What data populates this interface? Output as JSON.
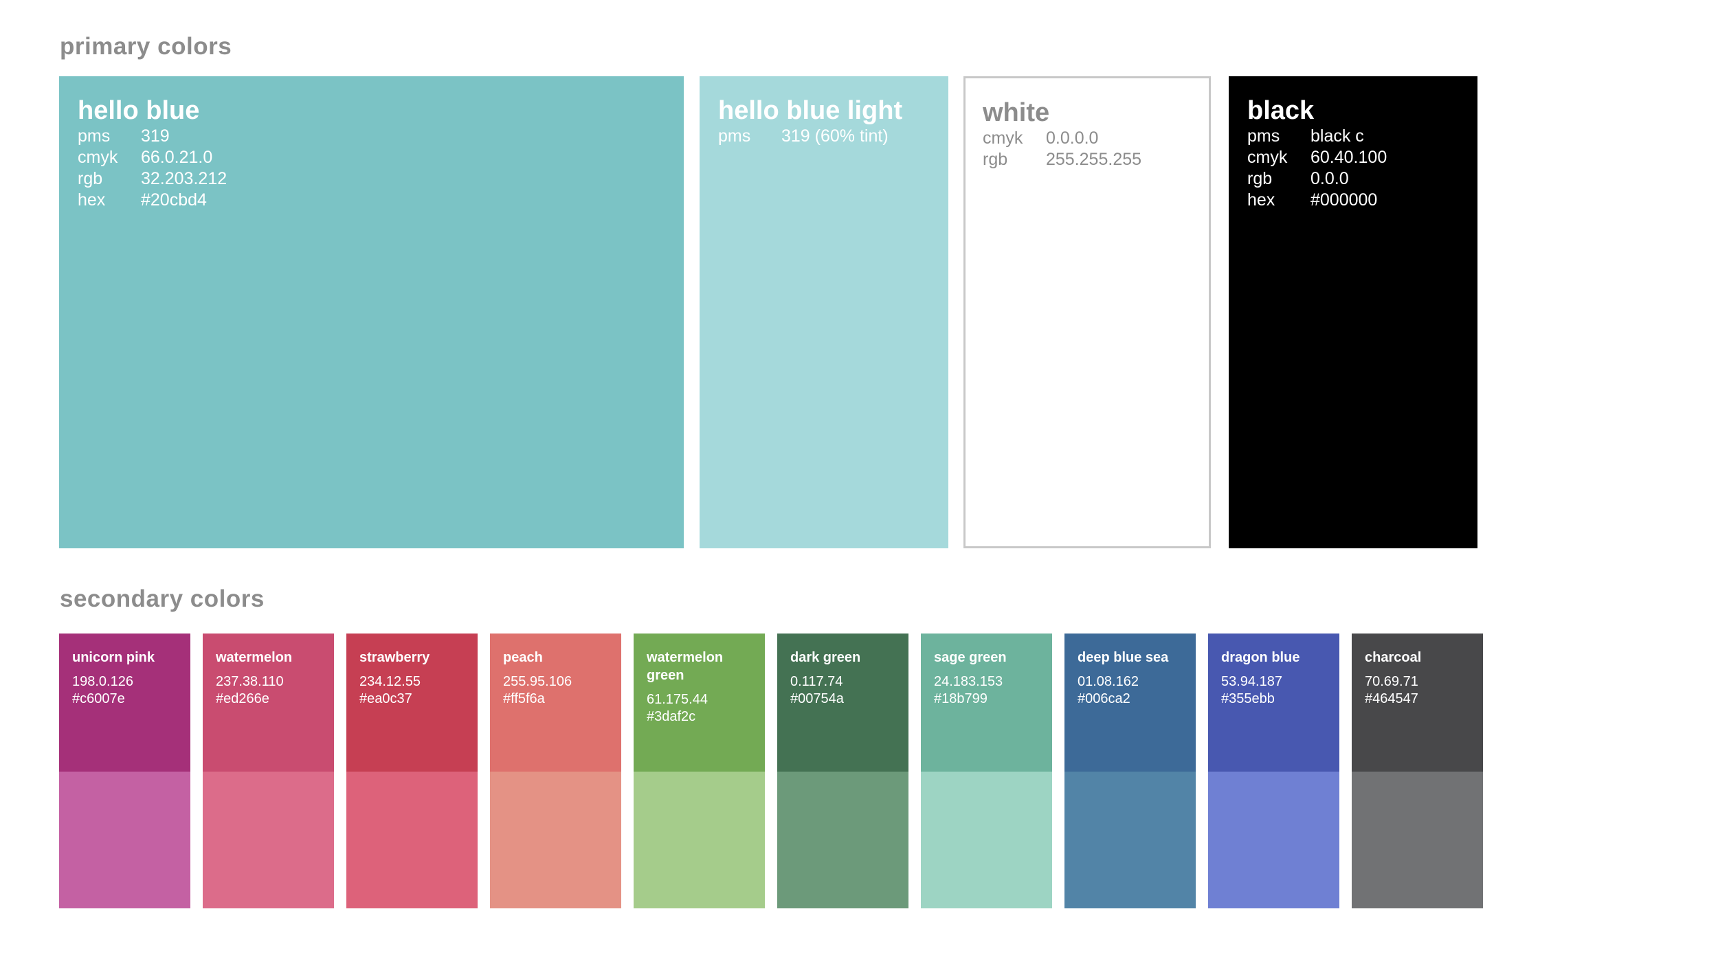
{
  "primary_title": "primary colors",
  "secondary_title": "secondary colors",
  "primary": [
    {
      "id": "hello-blue",
      "name": "hello blue",
      "bg": "#7bc3c5",
      "text_color": "#ffffff",
      "rows": [
        {
          "key": "pms",
          "value": "319"
        },
        {
          "key": "cmyk",
          "value": "66.0.21.0"
        },
        {
          "key": "rgb",
          "value": "32.203.212"
        },
        {
          "key": "hex",
          "value": "#20cbd4"
        }
      ]
    },
    {
      "id": "hello-blue-light",
      "name": "hello blue light",
      "bg": "#a5d9db",
      "text_color": "#ffffff",
      "rows": [
        {
          "key": "pms",
          "value": "319 (60% tint)"
        }
      ]
    },
    {
      "id": "white",
      "name": "white",
      "bg": "#ffffff",
      "text_color": "#8c8c8c",
      "rows": [
        {
          "key": "cmyk",
          "value": "0.0.0.0"
        },
        {
          "key": "rgb",
          "value": "255.255.255"
        }
      ]
    },
    {
      "id": "black",
      "name": "black",
      "bg": "#000000",
      "text_color": "#ffffff",
      "rows": [
        {
          "key": "pms",
          "value": "black c"
        },
        {
          "key": "cmyk",
          "value": "60.40.100"
        },
        {
          "key": "rgb",
          "value": "0.0.0"
        },
        {
          "key": "hex",
          "value": "#000000"
        }
      ]
    }
  ],
  "secondary": [
    {
      "name": "unicorn pink",
      "rgb": "198.0.126",
      "hex": "#c6007e",
      "top": "#a53079",
      "bottom": "#c461a3"
    },
    {
      "name": "watermelon",
      "rgb": "237.38.110",
      "hex": "#ed266e",
      "top": "#c94c70",
      "bottom": "#dc6c8a"
    },
    {
      "name": "strawberry",
      "rgb": "234.12.55",
      "hex": "#ea0c37",
      "top": "#c63f53",
      "bottom": "#dd627a"
    },
    {
      "name": "peach",
      "rgb": "255.95.106",
      "hex": "#ff5f6a",
      "top": "#de716d",
      "bottom": "#e49285"
    },
    {
      "name": "watermelon green",
      "rgb": "61.175.44",
      "hex": "#3daf2c",
      "top": "#73aa54",
      "bottom": "#a5cc8b"
    },
    {
      "name": "dark green",
      "rgb": "0.117.74",
      "hex": "#00754a",
      "top": "#447253",
      "bottom": "#6c9a7a"
    },
    {
      "name": "sage green",
      "rgb": "24.183.153",
      "hex": "#18b799",
      "top": "#6db39d",
      "bottom": "#9dd4c3"
    },
    {
      "name": "deep blue sea",
      "rgb": "01.08.162",
      "hex": "#006ca2",
      "top": "#3d6a98",
      "bottom": "#5284a7"
    },
    {
      "name": "dragon blue",
      "rgb": "53.94.187",
      "hex": "#355ebb",
      "top": "#4858b0",
      "bottom": "#6f80d3"
    },
    {
      "name": "charcoal",
      "rgb": "70.69.71",
      "hex": "#464547",
      "top": "#48484a",
      "bottom": "#717274"
    }
  ]
}
